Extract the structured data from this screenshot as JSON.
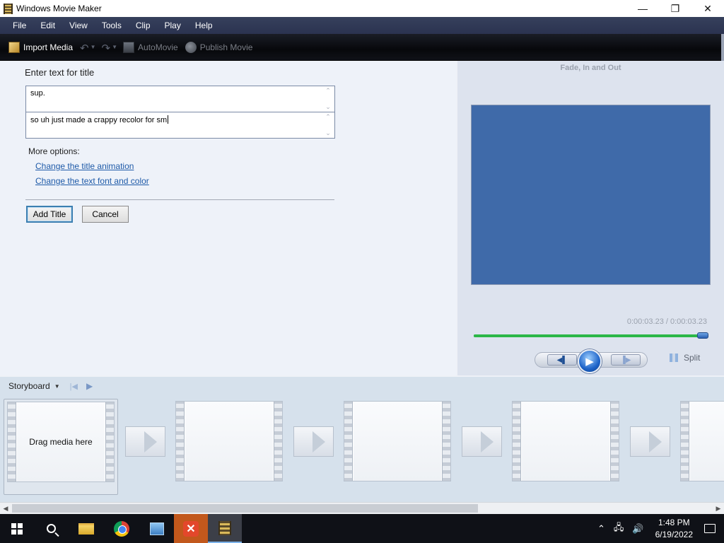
{
  "window": {
    "title": "Windows Movie Maker",
    "controls": {
      "minimize": "—",
      "maximize": "❐",
      "close": "✕"
    }
  },
  "menu": [
    "File",
    "Edit",
    "View",
    "Tools",
    "Clip",
    "Play",
    "Help"
  ],
  "toolbar": {
    "import_media": "Import Media",
    "automovie": "AutoMovie",
    "publish_movie": "Publish Movie"
  },
  "title_editor": {
    "heading": "Enter text for title",
    "line1": "sup.",
    "line2": "so uh just made a crappy recolor for sm",
    "more_options": "More options:",
    "link_animation": "Change the title animation",
    "link_font": "Change the text font and color",
    "add_button": "Add Title",
    "cancel_button": "Cancel"
  },
  "preview": {
    "effect_name": "Fade, In and Out",
    "time": "0:00:03.23 / 0:00:03.23",
    "progress_fraction": 1.0,
    "split_label": "Split",
    "screen_color": "#3f6aa9"
  },
  "storyboard": {
    "label": "Storyboard",
    "drop_hint": "Drag media here"
  },
  "taskbar": {
    "time": "1:48 PM",
    "date": "6/19/2022"
  },
  "colors": {
    "menubar": "#2b3350",
    "toolbar": "#07080b",
    "link": "#1e5aa8",
    "seek": "#2bb748",
    "taskbar": "#0f1117"
  }
}
